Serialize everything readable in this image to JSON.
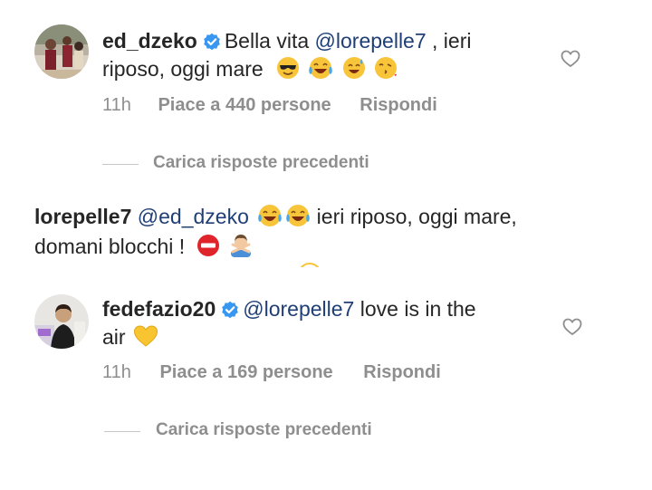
{
  "comment1": {
    "username": "ed_dzeko",
    "verified": true,
    "text_before": "Bella vita ",
    "mention": "@lorepelle7",
    "text_after": " , ieri",
    "line2": "riposo, oggi mare",
    "emojis": [
      "sunglasses-emoji",
      "tears-of-joy-emoji",
      "sweat-smile-emoji",
      "kiss-emoji"
    ],
    "time": "11h",
    "likes": "Piace a 440 persone",
    "reply": "Rispondi"
  },
  "load_more_1": "Carica risposte precedenti",
  "reply1": {
    "username": "lorepelle7",
    "mention": "@ed_dzeko",
    "emojis1": [
      "tears-of-joy-emoji",
      "tears-of-joy-emoji"
    ],
    "text_after": " ieri riposo, oggi mare,",
    "line2": "domani blocchi !",
    "emojis2": [
      "no-entry-emoji",
      "man-gesturing-no-emoji"
    ]
  },
  "comment2": {
    "username": "fedefazio20",
    "verified": true,
    "mention": "@lorepelle7",
    "text_after": " love is in the",
    "line2": "air",
    "emojis": [
      "yellow-heart-emoji"
    ],
    "time": "11h",
    "likes": "Piace a 169 persone",
    "reply": "Rispondi"
  },
  "load_more_2": "Carica risposte precedenti",
  "colors": {
    "text": "#262626",
    "mention": "#1f3f76",
    "meta": "#8e8e8e",
    "verified": "#3897f0"
  }
}
